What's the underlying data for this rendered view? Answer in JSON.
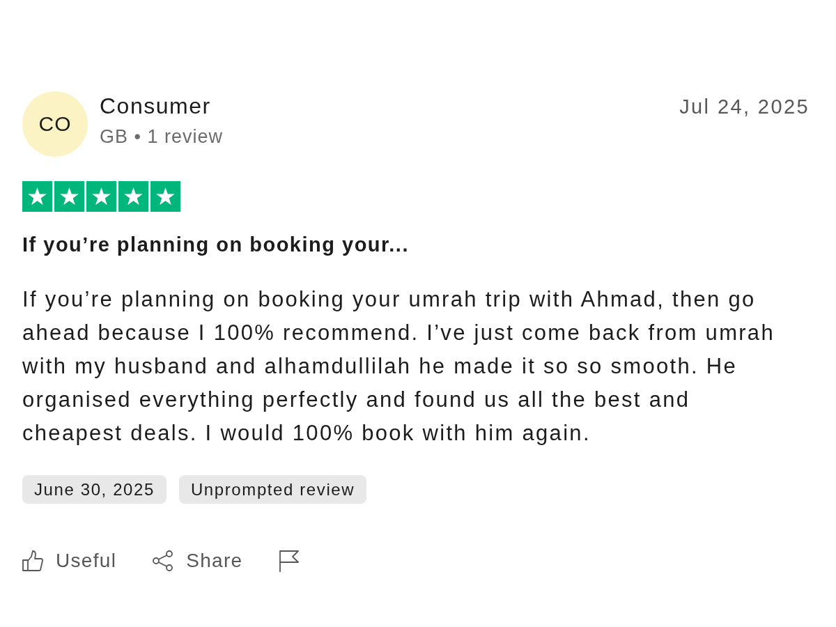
{
  "reviewer": {
    "initials": "CO",
    "name": "Consumer",
    "meta": "GB • 1 review"
  },
  "date": "Jul 24, 2025",
  "rating": {
    "stars": 5
  },
  "title": "If you’re planning on booking your...",
  "body": "If you’re planning on booking your umrah trip with Ahmad, then go ahead because I 100% recommend. I’ve just come back from umrah with my husband and alhamdullilah he made it so so smooth. He organised everything perfectly and found us all the best and cheapest deals. I would 100% book with him again.",
  "tags": [
    "June 30, 2025",
    "Unprompted review"
  ],
  "actions": [
    {
      "kind": "useful",
      "label": "Useful"
    },
    {
      "kind": "share",
      "label": "Share"
    },
    {
      "kind": "report"
    }
  ]
}
